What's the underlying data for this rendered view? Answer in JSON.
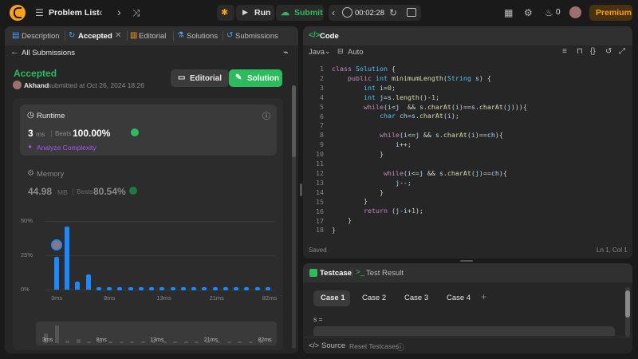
{
  "topbar": {
    "problem_list": "Problem List",
    "run": "Run",
    "submit": "Submit",
    "timer": "00:02:28",
    "flame_count": "0",
    "premium": "Premium"
  },
  "left_tabs": [
    "Description",
    "Accepted",
    "Editorial",
    "Solutions",
    "Submissions"
  ],
  "submission": {
    "back_label": "All Submissions",
    "status": "Accepted",
    "user": "Akhand",
    "submitted_at": "submitted at Oct 26, 2024 18:26",
    "editorial_btn": "Editorial",
    "solution_btn": "Solution"
  },
  "runtime": {
    "title": "Runtime",
    "value": "3",
    "unit": "ms",
    "beats_label": "Beats",
    "beats": "100.00%",
    "analyze": "Analyze Complexity"
  },
  "memory": {
    "title": "Memory",
    "value": "44.98",
    "unit": "MB",
    "beats_label": "Beats",
    "beats": "80.54%"
  },
  "chart_data": {
    "type": "bar",
    "title": "",
    "ylabel": "",
    "xlabel": "",
    "y_ticks": [
      "50%",
      "25%",
      "0%"
    ],
    "x_ticks": [
      "3ms",
      "8ms",
      "13ms",
      "21ms",
      "82ms"
    ],
    "ylim": [
      0,
      50
    ],
    "values": [
      24,
      46,
      6,
      11,
      0.6,
      0.6,
      0.6,
      0.6,
      0.6,
      0.6,
      0.6,
      0.6,
      0.6,
      0.6,
      0.6,
      0.6,
      0.6,
      0.6,
      0.6,
      0.6,
      0.6
    ],
    "highlight_index": 0,
    "colors": {
      "bar": "#1e88ff"
    }
  },
  "mini_x_ticks": [
    "3ms",
    "8ms",
    "13ms",
    "21ms",
    "82ms"
  ],
  "code_panel": {
    "title": "Code",
    "language": "Java",
    "mode": "Auto",
    "status": "Saved",
    "cursor": "Ln 1, Col 1",
    "lines": [
      [
        [
          "kw",
          "class "
        ],
        [
          "ty",
          "Solution"
        ],
        [
          "pl",
          " {"
        ]
      ],
      [
        [
          "pl",
          "    "
        ],
        [
          "kw",
          "public "
        ],
        [
          "ty",
          "int "
        ],
        [
          "fn",
          "minimumLength"
        ],
        [
          "pl",
          "("
        ],
        [
          "ty",
          "String "
        ],
        [
          "var",
          "s"
        ],
        [
          "pl",
          ") {"
        ]
      ],
      [
        [
          "pl",
          "        "
        ],
        [
          "ty",
          "int "
        ],
        [
          "var",
          "i"
        ],
        [
          "pl",
          "="
        ],
        [
          "num",
          "0"
        ],
        [
          "pl",
          ";"
        ]
      ],
      [
        [
          "pl",
          "        "
        ],
        [
          "ty",
          "int "
        ],
        [
          "var",
          "j"
        ],
        [
          "pl",
          "="
        ],
        [
          "var",
          "s"
        ],
        [
          "pl",
          "."
        ],
        [
          "fn",
          "length"
        ],
        [
          "pl",
          "()-"
        ],
        [
          "num",
          "1"
        ],
        [
          "pl",
          ";"
        ]
      ],
      [
        [
          "pl",
          "        "
        ],
        [
          "kw",
          "while"
        ],
        [
          "pl",
          "("
        ],
        [
          "var",
          "i"
        ],
        [
          "pl",
          "<"
        ],
        [
          "var",
          "j"
        ],
        [
          "pl",
          "  && "
        ],
        [
          "var",
          "s"
        ],
        [
          "pl",
          "."
        ],
        [
          "fn",
          "charAt"
        ],
        [
          "pl",
          "("
        ],
        [
          "var",
          "i"
        ],
        [
          "pl",
          ")=="
        ],
        [
          "var",
          "s"
        ],
        [
          "pl",
          "."
        ],
        [
          "fn",
          "charAt"
        ],
        [
          "pl",
          "("
        ],
        [
          "var",
          "j"
        ],
        [
          "pl",
          "))){"
        ]
      ],
      [
        [
          "pl",
          "            "
        ],
        [
          "ty",
          "char "
        ],
        [
          "var",
          "ch"
        ],
        [
          "pl",
          "="
        ],
        [
          "var",
          "s"
        ],
        [
          "pl",
          "."
        ],
        [
          "fn",
          "charAt"
        ],
        [
          "pl",
          "("
        ],
        [
          "var",
          "i"
        ],
        [
          "pl",
          ");"
        ]
      ],
      [
        [
          "pl",
          ""
        ]
      ],
      [
        [
          "pl",
          "            "
        ],
        [
          "kw",
          "while"
        ],
        [
          "pl",
          "("
        ],
        [
          "var",
          "i"
        ],
        [
          "pl",
          "<="
        ],
        [
          "var",
          "j"
        ],
        [
          "pl",
          " && "
        ],
        [
          "var",
          "s"
        ],
        [
          "pl",
          "."
        ],
        [
          "fn",
          "charAt"
        ],
        [
          "pl",
          "("
        ],
        [
          "var",
          "i"
        ],
        [
          "pl",
          ")=="
        ],
        [
          "var",
          "ch"
        ],
        [
          "pl",
          "){"
        ]
      ],
      [
        [
          "pl",
          "                "
        ],
        [
          "var",
          "i"
        ],
        [
          "pl",
          "++;"
        ]
      ],
      [
        [
          "pl",
          "            }"
        ]
      ],
      [
        [
          "pl",
          ""
        ]
      ],
      [
        [
          "pl",
          "             "
        ],
        [
          "kw",
          "while"
        ],
        [
          "pl",
          "("
        ],
        [
          "var",
          "i"
        ],
        [
          "pl",
          "<="
        ],
        [
          "var",
          "j"
        ],
        [
          "pl",
          " && "
        ],
        [
          "var",
          "s"
        ],
        [
          "pl",
          "."
        ],
        [
          "fn",
          "charAt"
        ],
        [
          "pl",
          "("
        ],
        [
          "var",
          "j"
        ],
        [
          "pl",
          ")=="
        ],
        [
          "var",
          "ch"
        ],
        [
          "pl",
          "){"
        ]
      ],
      [
        [
          "pl",
          "                "
        ],
        [
          "var",
          "j"
        ],
        [
          "pl",
          "--;"
        ]
      ],
      [
        [
          "pl",
          "            }"
        ]
      ],
      [
        [
          "pl",
          "        }"
        ]
      ],
      [
        [
          "pl",
          "        "
        ],
        [
          "kw",
          "return "
        ],
        [
          "pl",
          "("
        ],
        [
          "var",
          "j"
        ],
        [
          "pl",
          "-"
        ],
        [
          "var",
          "i"
        ],
        [
          "pl",
          "+"
        ],
        [
          "num",
          "1"
        ],
        [
          "pl",
          ");"
        ]
      ],
      [
        [
          "pl",
          "    }"
        ]
      ],
      [
        [
          "pl",
          "}"
        ]
      ]
    ]
  },
  "testcase_panel": {
    "tab_testcase": "Testcase",
    "tab_result": "Test Result",
    "cases": [
      "Case 1",
      "Case 2",
      "Case 3",
      "Case 4"
    ],
    "add": "+",
    "input_label": "s =",
    "source": "Source",
    "reset": "Reset Testcases"
  }
}
